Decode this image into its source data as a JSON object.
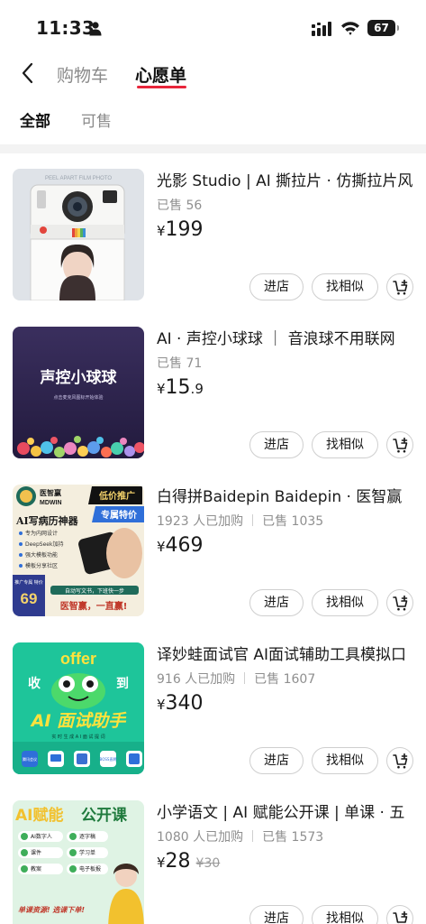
{
  "status_bar": {
    "time": "11:33",
    "battery": "67"
  },
  "nav": {
    "tabs": [
      {
        "label": "购物车"
      },
      {
        "label": "心愿单"
      }
    ]
  },
  "filters": [
    {
      "label": "全部"
    },
    {
      "label": "可售"
    }
  ],
  "colors": {
    "accent": "#e8253b"
  },
  "products": [
    {
      "title": "光影 Studio | AI 撕拉片 · 仿撕拉片风",
      "purchased": "",
      "sold": "已售 56",
      "price_int": "199",
      "price_dec": "",
      "price_original": "",
      "thumb": {
        "top_text": "PEEL APART FILM PHOTO"
      }
    },
    {
      "title": "AI · 声控小球球 ｜ 音浪球不用联网",
      "purchased": "",
      "sold": "已售 71",
      "price_int": "15",
      "price_dec": ".9",
      "price_original": "",
      "thumb": {
        "title": "声控小球球",
        "subtitle": "点击麦克风图标开始体验"
      }
    },
    {
      "title": "白得拼Baidepin Baidepin · 医智赢",
      "purchased": "1923 人已加购",
      "sold": "已售 1035",
      "price_int": "469",
      "price_dec": "",
      "price_original": "",
      "thumb": {
        "logo_name": "医智赢",
        "logo_en": "MDWIN",
        "heading": "AI写病历神器",
        "features": [
          "专为内网设计",
          "DeepSeek加持",
          "强大模板功能",
          "模板分享社区"
        ],
        "promo_badge": "低价推广",
        "special_badge": "专属特价",
        "price_label": "推广专属 特价",
        "price": "69",
        "tagline": "自动写文书，下班快一步",
        "slogan": "医智赢，一直赢!"
      }
    },
    {
      "title": "译妙蛙面试官 AI面试辅助工具模拟口",
      "purchased": "916 人已加购",
      "sold": "已售 1607",
      "price_int": "340",
      "price_dec": "",
      "price_original": "",
      "thumb": {
        "offer": "offer",
        "left": "收",
        "right": "到",
        "heading": "AI 面试助手",
        "sub": "实 时 生 成 A I 面 试 提 词",
        "app_labels": [
          "腾讯会议",
          "",
          "",
          "BOSS直聘",
          ""
        ]
      }
    },
    {
      "title": "小学语文 | AI 赋能公开课 | 单课 · 五",
      "purchased": "1080 人已加购",
      "sold": "已售 1573",
      "price_int": "28",
      "price_dec": "",
      "price_original": "¥30",
      "thumb": {
        "heading_ai": "AI赋能",
        "heading_rest": "公开课",
        "checks": [
          "AI数字人",
          "逐字稿",
          "课件",
          "学习单",
          "教案",
          "电子板报"
        ],
        "bottom": "单课资源! 选课下单!"
      }
    }
  ],
  "buttons": {
    "shop": "进店",
    "similar": "找相似"
  }
}
